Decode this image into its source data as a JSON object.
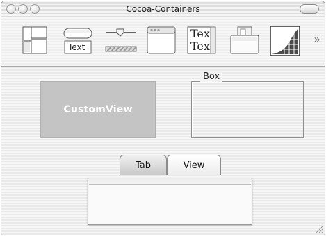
{
  "window": {
    "title": "Cocoa-Containers"
  },
  "toolbar": {
    "items": [
      {
        "icon": "split-view-icon"
      },
      {
        "icon": "button-text-icon",
        "label": "Text"
      },
      {
        "icon": "slider-progress-icon"
      },
      {
        "icon": "window-icon"
      },
      {
        "icon": "text-view-icon",
        "lines": [
          "Tex",
          "Tex"
        ]
      },
      {
        "icon": "box-stack-icon"
      },
      {
        "icon": "graph-icon"
      }
    ],
    "overflow": "»"
  },
  "content": {
    "custom_view_label": "CustomView",
    "box_title": "Box",
    "tabs": [
      {
        "label": "Tab",
        "selected": true
      },
      {
        "label": "View",
        "selected": false
      }
    ]
  },
  "colors": {
    "custom_view_fill": "#c4c4c4",
    "custom_view_text": "#ffffff",
    "window_stripe_light": "#f7f7f7",
    "window_stripe_dark": "#e9e9e9"
  }
}
